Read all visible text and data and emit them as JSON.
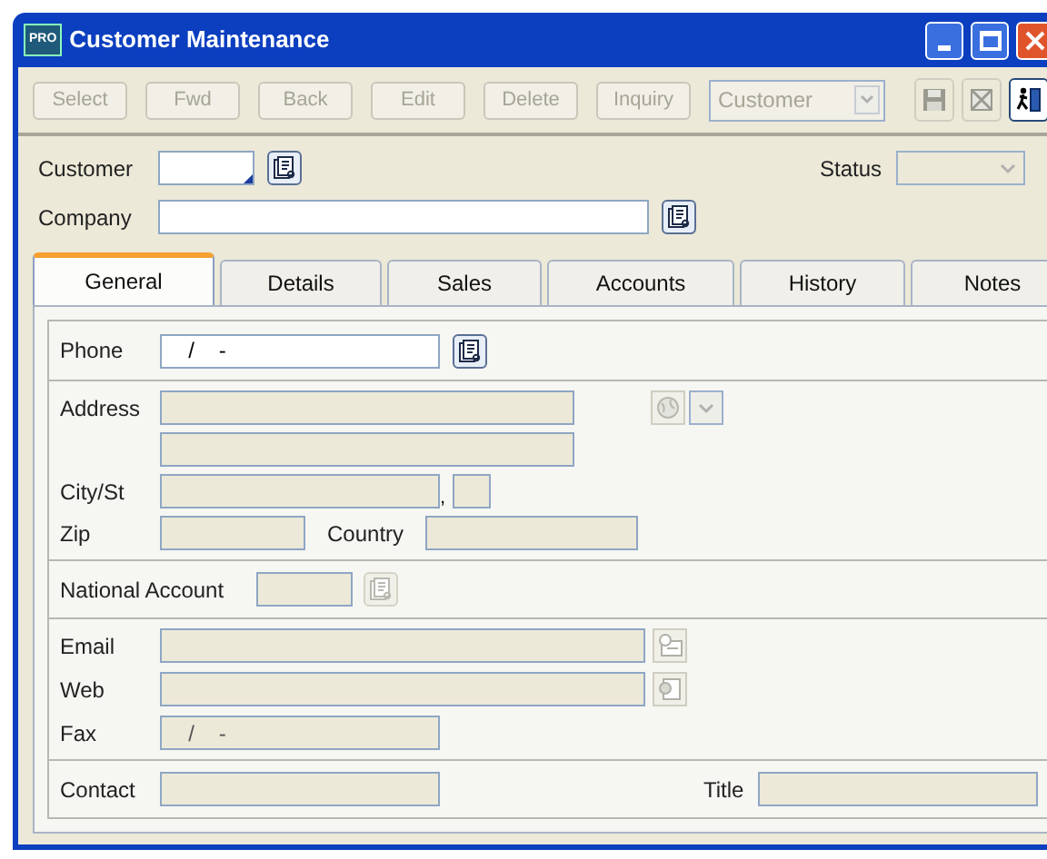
{
  "window": {
    "title": "Customer Maintenance",
    "app_badge": "PRO"
  },
  "toolbar": {
    "buttons": [
      {
        "label": "Select",
        "disabled": true
      },
      {
        "label": "Fwd",
        "disabled": true
      },
      {
        "label": "Back",
        "disabled": true
      },
      {
        "label": "Edit",
        "disabled": true
      },
      {
        "label": "Delete",
        "disabled": true
      },
      {
        "label": "Inquiry",
        "disabled": true
      }
    ],
    "dropdown": {
      "value": "Customer",
      "disabled": true
    }
  },
  "header": {
    "customer": {
      "label": "Customer"
    },
    "status": {
      "label": "Status",
      "disabled": true
    },
    "company": {
      "label": "Company"
    }
  },
  "tabs": [
    {
      "label": "General",
      "selected": true
    },
    {
      "label": "Details",
      "selected": false
    },
    {
      "label": "Sales",
      "selected": false
    },
    {
      "label": "Accounts",
      "selected": false
    },
    {
      "label": "History",
      "selected": false
    },
    {
      "label": "Notes",
      "selected": false
    }
  ],
  "general": {
    "phone": {
      "label": "Phone",
      "value": "  /    -",
      "disabled": false
    },
    "address": {
      "label": "Address",
      "disabled": true
    },
    "city": {
      "label": "City/St",
      "separator": ",",
      "disabled": true
    },
    "zip": {
      "label": "Zip",
      "disabled": true
    },
    "country": {
      "label": "Country",
      "disabled": true
    },
    "national_account": {
      "label": "National Account",
      "disabled": true
    },
    "email": {
      "label": "Email",
      "disabled": true
    },
    "web": {
      "label": "Web",
      "disabled": true
    },
    "fax": {
      "label": "Fax",
      "value": "  /    -",
      "disabled": true
    },
    "contact": {
      "label": "Contact",
      "disabled": true
    },
    "title": {
      "label": "Title",
      "disabled": true
    }
  }
}
